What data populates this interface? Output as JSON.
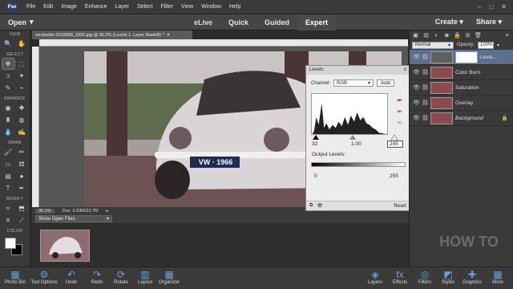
{
  "menubar": {
    "logo": "Pse",
    "items": [
      "File",
      "Edit",
      "Image",
      "Enhance",
      "Layer",
      "Select",
      "Filter",
      "View",
      "Window",
      "Help"
    ],
    "controls": [
      "–",
      "□",
      "✕"
    ]
  },
  "modebar": {
    "open_label": "Open",
    "tabs": [
      "eLive",
      "Quick",
      "Guided",
      "Expert"
    ],
    "active_tab": "Expert",
    "create_label": "Create",
    "share_label": "Share"
  },
  "toolbox": {
    "sections": [
      "VIEW",
      "SELECT",
      "ENHANCE",
      "DRAW",
      "MODIFY",
      "COLOR"
    ],
    "fg_color": "#ffffff",
    "bg_color": "#000000"
  },
  "document": {
    "tab_title": "vw-beetle-1510689_1920.jpg @ 36.2% (Levels 1, Layer Mask/8) *",
    "zoom": "36.2%",
    "doc_size": "Doc: 5.93M/23.7M"
  },
  "photo": {
    "plate_text": "VW · 1966"
  },
  "levels_panel": {
    "title": "Levels",
    "channel_label": "Channel:",
    "channel_value": "RGB",
    "auto_label": "Auto",
    "input_black": "32",
    "input_gray": "1.00",
    "input_white": "245",
    "output_label": "Output Levels:",
    "output_black": "0",
    "output_white": "255",
    "reset_label": "Reset"
  },
  "layers_panel": {
    "blend_mode": "Normal",
    "opacity_label": "Opacity:",
    "opacity_value": "100%",
    "layers": [
      {
        "name": "Level...",
        "active": true
      },
      {
        "name": "Color Burn",
        "active": false
      },
      {
        "name": "Saturation",
        "active": false
      },
      {
        "name": "Overlay",
        "active": false
      },
      {
        "name": "Background",
        "active": false
      }
    ]
  },
  "photo_bin": {
    "show_label": "Show Open Files"
  },
  "taskbar": {
    "left": [
      "Photo Bin",
      "Tool Options",
      "Undo",
      "Redo",
      "Rotate",
      "Layout",
      "Organizer"
    ],
    "right": [
      "Layers",
      "Effects",
      "Filters",
      "Styles",
      "Graphics",
      "More"
    ]
  },
  "watermark": "HOW TO"
}
